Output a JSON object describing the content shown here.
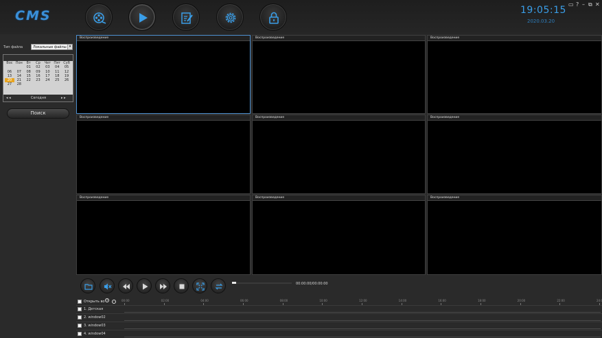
{
  "header": {
    "logo": "CMS",
    "nav": [
      {
        "name": "monitor-nav-button",
        "icon": "film-reel-icon"
      },
      {
        "name": "playback-nav-button",
        "icon": "play-icon"
      },
      {
        "name": "log-nav-button",
        "icon": "edit-document-icon"
      },
      {
        "name": "settings-nav-button",
        "icon": "gear-icon"
      },
      {
        "name": "lock-nav-button",
        "icon": "lock-icon"
      }
    ],
    "time": "19:05:15",
    "date": "2020.03.20",
    "window_controls": [
      "▭",
      "?",
      "–",
      "⧉",
      "✕"
    ]
  },
  "left_panel": {
    "file_type_label": "Тип файла",
    "file_type_value": "Локальные файлы за",
    "calendar": {
      "weekdays": [
        "Вос",
        "Пон",
        "Вт",
        "Ср",
        "Чет",
        "Пят",
        "Суб"
      ],
      "days": [
        "",
        "",
        "01",
        "02",
        "03",
        "04",
        "05",
        "06",
        "07",
        "08",
        "09",
        "10",
        "11",
        "12",
        "13",
        "14",
        "15",
        "16",
        "17",
        "18",
        "19",
        "20",
        "21",
        "22",
        "23",
        "24",
        "25",
        "26",
        "27",
        "28",
        "",
        "",
        "",
        "",
        ""
      ],
      "selected_day": "20",
      "today_label": "Сегодня",
      "nav_prev": "◂ ◂",
      "nav_next": "▸ ▸"
    },
    "search_label": "Поиск"
  },
  "grid": {
    "cell_title": "Воспроизведение"
  },
  "controls": {
    "time": "00:00:00/00:00:00",
    "accent": "#3a9ee8"
  },
  "channels": {
    "open_label": "Открыть во",
    "ticks": [
      "00:00",
      "02:00",
      "04:00",
      "06:00",
      "08:00",
      "10:00",
      "12:00",
      "14:00",
      "16:00",
      "18:00",
      "20:00",
      "22:00",
      "24:00"
    ],
    "rows": [
      "1. Детская",
      "2. window02",
      "3. window03",
      "4. window04"
    ]
  }
}
